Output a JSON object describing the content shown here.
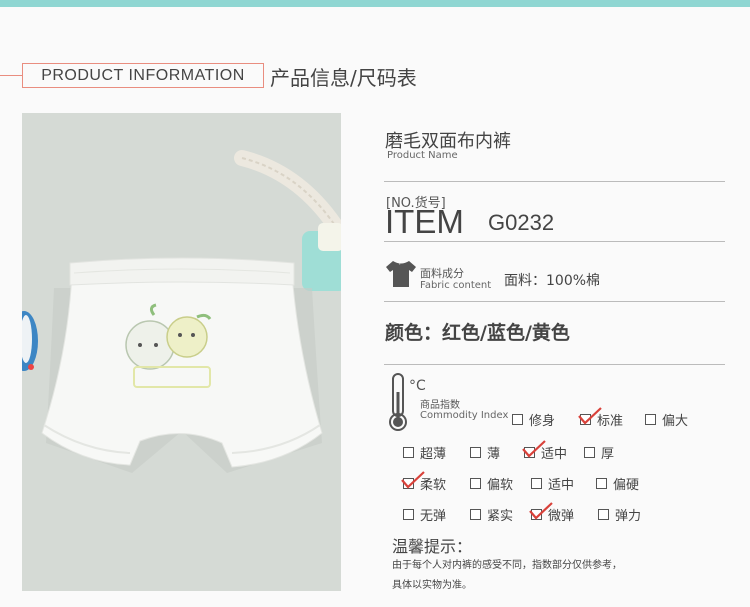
{
  "header": {
    "title_en": "PRODUCT  INFORMATION",
    "title_cn": "产品信息/尺码表"
  },
  "product": {
    "name": "磨毛双面布内裤",
    "name_label_en": "Product  Name",
    "no_label": "[NO.货号]",
    "item_label": "ITEM",
    "item_code": "G0232",
    "fabric_label_cn": "面料成分",
    "fabric_label_en": "Fabric content",
    "fabric_value": "面料：100%棉",
    "colors": "颜色：红色/蓝色/黄色"
  },
  "comfort": {
    "degree_symbol": "°C",
    "label_cn": "商品指数",
    "label_en": "Commodity Index",
    "rows": [
      [
        {
          "label": "修身",
          "checked": false
        },
        {
          "label": "标准",
          "checked": true
        },
        {
          "label": "偏大",
          "checked": false
        }
      ],
      [
        {
          "label": "超薄",
          "checked": false
        },
        {
          "label": "薄",
          "checked": false
        },
        {
          "label": "适中",
          "checked": true
        },
        {
          "label": "厚",
          "checked": false
        }
      ],
      [
        {
          "label": "柔软",
          "checked": true
        },
        {
          "label": "偏软",
          "checked": false
        },
        {
          "label": "适中",
          "checked": false
        },
        {
          "label": "偏硬",
          "checked": false
        }
      ],
      [
        {
          "label": "无弹",
          "checked": false
        },
        {
          "label": "紧实",
          "checked": false
        },
        {
          "label": "微弹",
          "checked": true
        },
        {
          "label": "弹力",
          "checked": false
        }
      ]
    ]
  },
  "tips": {
    "title": "温馨提示：",
    "line1": "由于每个人对内裤的感受不同，指数部分仅供参考，",
    "line2": "具体以实物为准。"
  },
  "colors": {
    "accent_teal": "#8fd6d2",
    "header_border": "#e98d7f",
    "check_red": "#d9413a"
  },
  "icons": [
    "tshirt-icon",
    "thermometer-icon",
    "checkmark-icon"
  ]
}
